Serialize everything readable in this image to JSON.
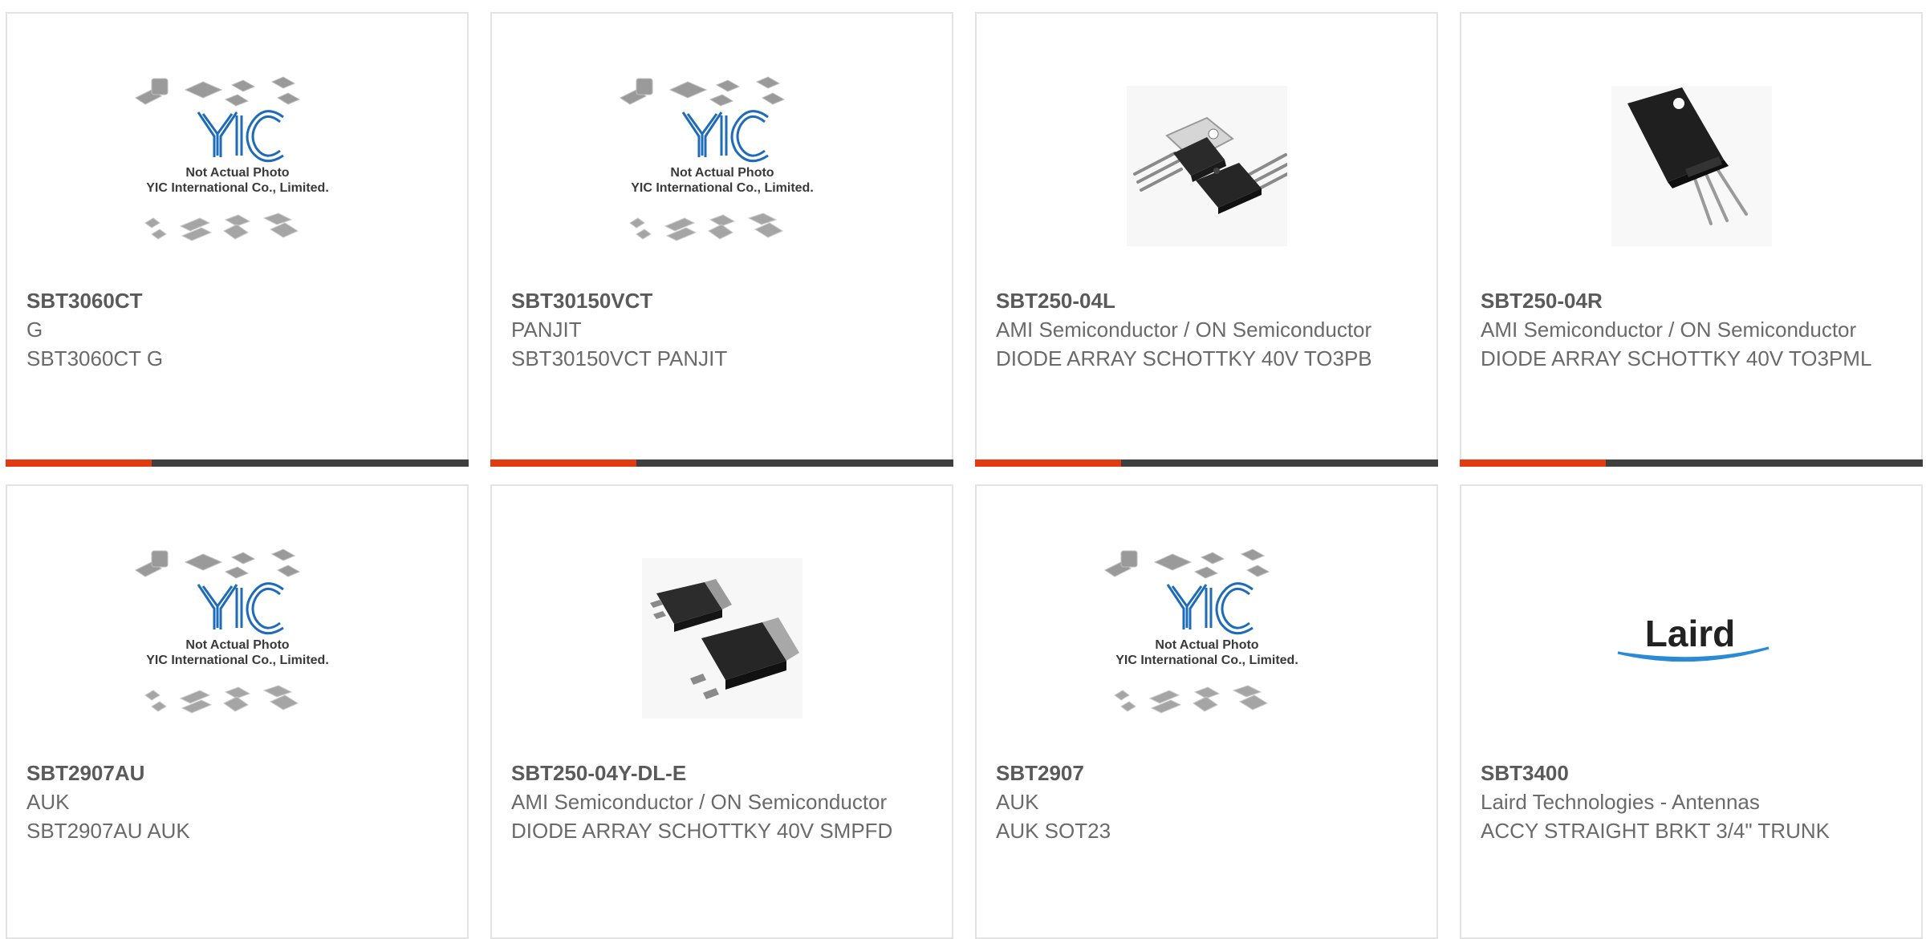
{
  "products": [
    {
      "part": "SBT3060CT",
      "mfr": "G",
      "desc": "SBT3060CT G",
      "image": "yic-placeholder"
    },
    {
      "part": "SBT30150VCT",
      "mfr": "PANJIT",
      "desc": "SBT30150VCT PANJIT",
      "image": "yic-placeholder"
    },
    {
      "part": "SBT250-04L",
      "mfr": "AMI Semiconductor / ON Semiconductor",
      "desc": "DIODE ARRAY SCHOTTKY 40V TO3PB",
      "image": "to3pb-photo"
    },
    {
      "part": "SBT250-04R",
      "mfr": "AMI Semiconductor / ON Semiconductor",
      "desc": "DIODE ARRAY SCHOTTKY 40V TO3PML",
      "image": "to3pml-photo"
    },
    {
      "part": "SBT2907AU",
      "mfr": "AUK",
      "desc": "SBT2907AU AUK",
      "image": "yic-placeholder"
    },
    {
      "part": "SBT250-04Y-DL-E",
      "mfr": "AMI Semiconductor / ON Semiconductor",
      "desc": "DIODE ARRAY SCHOTTKY 40V SMPFD",
      "image": "smpfd-photo"
    },
    {
      "part": "SBT2907",
      "mfr": "AUK",
      "desc": "AUK SOT23",
      "image": "yic-placeholder"
    },
    {
      "part": "SBT3400",
      "mfr": "Laird Technologies - Antennas",
      "desc": "ACCY STRAIGHT BRKT 3/4\" TRUNK",
      "image": "laird-logo"
    }
  ],
  "placeholder": {
    "line1": "Not Actual Photo",
    "line2": "YIC International Co., Limited.",
    "logo": "YIC"
  },
  "laird": {
    "logo": "Laird"
  },
  "colors": {
    "accent": "#e33a12",
    "bar": "#3f3f3f",
    "text": "#6a6a6a",
    "border": "#e3e3e3",
    "yic_blue": "#1e6bb8"
  }
}
